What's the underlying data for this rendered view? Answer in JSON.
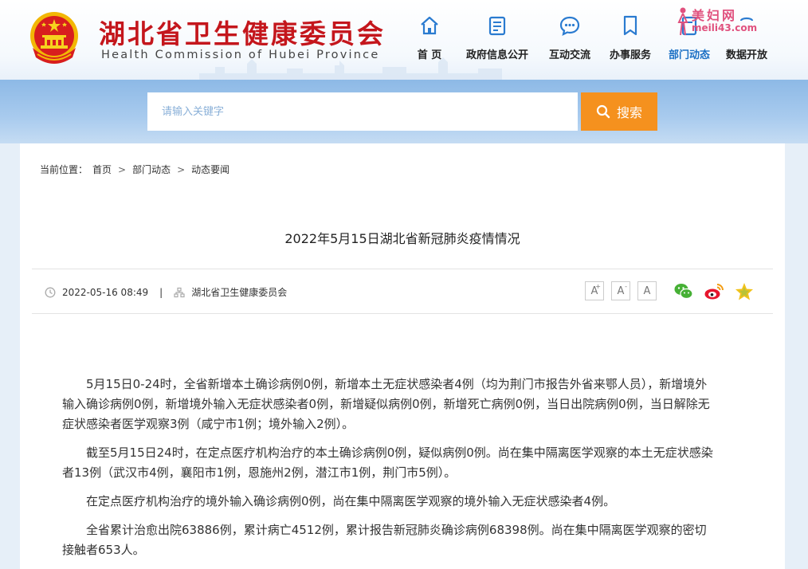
{
  "site": {
    "title_cn": "湖北省卫生健康委员会",
    "title_en": "Health Commission of Hubei Province"
  },
  "nav": {
    "items": [
      {
        "label": "首 页",
        "icon": "home-icon"
      },
      {
        "label": "政府信息公开",
        "icon": "document-list-icon"
      },
      {
        "label": "互动交流",
        "icon": "chat-bubble-icon"
      },
      {
        "label": "办事服务",
        "icon": "bookmark-icon"
      },
      {
        "label": "部门动态",
        "icon": "department-icon",
        "active": true
      },
      {
        "label": "数据开放",
        "icon": "data-icon"
      }
    ]
  },
  "watermark": {
    "line1": "美妇网",
    "line2": "meili43.com"
  },
  "search": {
    "placeholder": "请输入关键字",
    "button_label": "搜索"
  },
  "breadcrumb": {
    "prefix": "当前位置：",
    "items": [
      "首页",
      "部门动态",
      "动态要闻"
    ],
    "separator": ">"
  },
  "article": {
    "title": "2022年5月15日湖北省新冠肺炎疫情情况",
    "date": "2022-05-16 08:49",
    "source": "湖北省卫生健康委员会",
    "font_sizes": [
      "A",
      "A",
      "A"
    ],
    "paragraphs": [
      "5月15日0-24时，全省新增本土确诊病例0例，新增本土无症状感染者4例（均为荆门市报告外省来鄂人员），新增境外输入确诊病例0例，新增境外输入无症状感染者0例，新增疑似病例0例，新增死亡病例0例，当日出院病例0例，当日解除无症状感染者医学观察3例（咸宁市1例；境外输入2例）。",
      "截至5月15日24时，在定点医疗机构治疗的本土确诊病例0例，疑似病例0例。尚在集中隔离医学观察的本土无症状感染者13例（武汉市4例，襄阳市1例，恩施州2例，潜江市1例，荆门市5例）。",
      "在定点医疗机构治疗的境外输入确诊病例0例，尚在集中隔离医学观察的境外输入无症状感染者4例。",
      "全省累计治愈出院63886例，累计病亡4512例，累计报告新冠肺炎确诊病例68398例。尚在集中隔离医学观察的密切接触者653人。"
    ]
  },
  "colors": {
    "brand_red": "#c4161c",
    "accent_blue": "#1a6fc4",
    "search_orange": "#f5911e"
  }
}
